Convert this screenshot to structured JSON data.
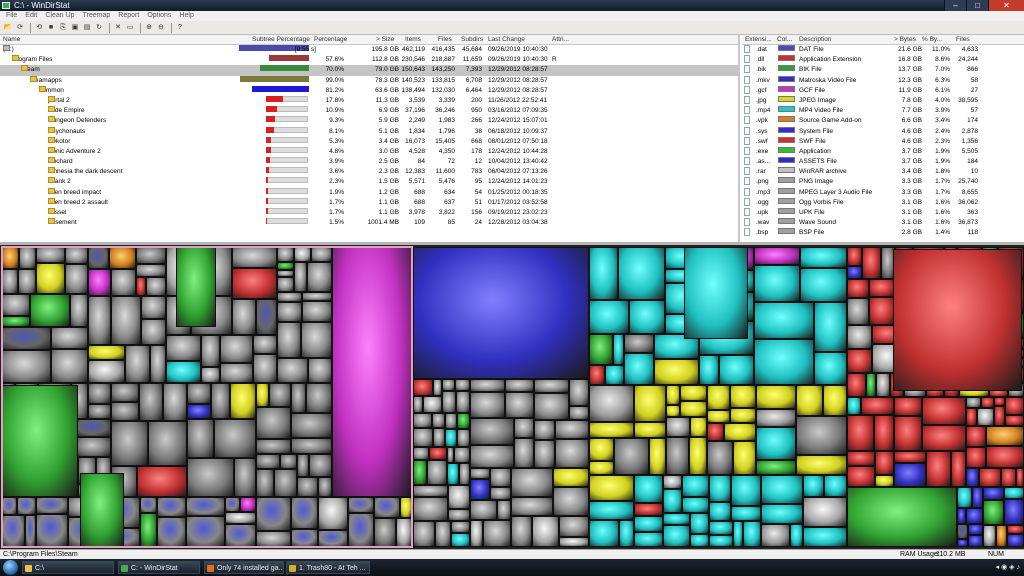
{
  "window": {
    "title": "C:\\ - WinDirStat"
  },
  "menu": [
    "File",
    "Edit",
    "Clean Up",
    "Treemap",
    "Report",
    "Options",
    "Help"
  ],
  "toolbar_icons": [
    "open-icon",
    "refresh-icon",
    "refresh-all-icon",
    "stop-icon",
    "copy-path-icon",
    "explorer-icon",
    "command-prompt-icon",
    "refresh-selected-icon",
    "delete-icon",
    "new-folder-icon",
    "zoom-in-icon",
    "zoom-out-icon",
    "help-icon"
  ],
  "tree": {
    "headers": {
      "name": "Name",
      "subtree": "Subtree Percentage",
      "pct": "Percentage",
      "size": "> Size",
      "items": "Items",
      "files": "Files",
      "subdirs": "Subdirs",
      "last": "Last Change",
      "attr": "Attri..."
    },
    "rows": [
      {
        "name": "(C:)",
        "subtree_text": "[9:55 s]",
        "pct": "",
        "size": "195.8 GB",
        "items": "462,119",
        "files": "416,435",
        "subdirs": "45,684",
        "last": "09/26/2019  10:40:30",
        "attr": "",
        "level": 0,
        "bar": 1.0,
        "bar_color": "#4a4aa8",
        "icon": "drive"
      },
      {
        "name": "Program Files",
        "subtree_text": "",
        "pct": "57.6%",
        "size": "112.8 GB",
        "items": "230,546",
        "files": "218,887",
        "subdirs": "11,659",
        "last": "09/26/2019  10:40:30",
        "attr": "R",
        "level": 1,
        "bar": 0.576,
        "bar_color": "#9a3a3a",
        "icon": "folder"
      },
      {
        "name": "Steam",
        "subtree_text": "",
        "pct": "70.0%",
        "size": "79.0 GB",
        "items": "150,643",
        "files": "143,250",
        "subdirs": "7,393",
        "last": "12/29/2012  08:28:57",
        "attr": "",
        "level": 2,
        "bar": 0.7,
        "bar_color": "#3a8a3a",
        "icon": "folder",
        "selected": true
      },
      {
        "name": "steamapps",
        "subtree_text": "",
        "pct": "99.0%",
        "size": "78.3 GB",
        "items": "140,523",
        "files": "133,815",
        "subdirs": "6,708",
        "last": "12/29/2012  08:28:57",
        "attr": "",
        "level": 3,
        "bar": 0.99,
        "bar_color": "#7a7a3a",
        "icon": "folder"
      },
      {
        "name": "common",
        "subtree_text": "",
        "pct": "81.2%",
        "size": "63.6 GB",
        "items": "138,494",
        "files": "132,030",
        "subdirs": "6,464",
        "last": "12/29/2012  08:28:57",
        "attr": "",
        "level": 4,
        "bar": 0.812,
        "bar_color": "#1a1ad8",
        "icon": "folder"
      },
      {
        "name": "portal 2",
        "subtree_text": "",
        "pct": "17.8%",
        "size": "11.3 GB",
        "items": "3,539",
        "files": "3,339",
        "subdirs": "200",
        "last": "11/26/2012  22:52:41",
        "attr": "",
        "level": 5,
        "bar": 0.178,
        "bar_color": "#d82020",
        "icon": "folder"
      },
      {
        "name": "Jade Empire",
        "subtree_text": "",
        "pct": "10.9%",
        "size": "6.9 GB",
        "items": "37,196",
        "files": "36,246",
        "subdirs": "950",
        "last": "03/16/2012  07:09:35",
        "attr": "",
        "level": 5,
        "bar": 0.109,
        "bar_color": "#d82020",
        "icon": "folder"
      },
      {
        "name": "Dungeon Defenders",
        "subtree_text": "",
        "pct": "9.3%",
        "size": "5.9 GB",
        "items": "2,249",
        "files": "1,983",
        "subdirs": "266",
        "last": "12/24/2012  15:07:01",
        "attr": "",
        "level": 5,
        "bar": 0.093,
        "bar_color": "#d82020",
        "icon": "folder"
      },
      {
        "name": "Psychonauts",
        "subtree_text": "",
        "pct": "8.1%",
        "size": "5.1 GB",
        "items": "1,834",
        "files": "1,796",
        "subdirs": "38",
        "last": "06/18/2012  10:09:37",
        "attr": "",
        "level": 5,
        "bar": 0.081,
        "bar_color": "#d82020",
        "icon": "folder"
      },
      {
        "name": "swkotor",
        "subtree_text": "",
        "pct": "5.3%",
        "size": "3.4 GB",
        "items": "16,073",
        "files": "15,405",
        "subdirs": "668",
        "last": "08/01/2012  07:50:18",
        "attr": "",
        "level": 5,
        "bar": 0.053,
        "bar_color": "#d82020",
        "icon": "folder"
      },
      {
        "name": "Sonic Adventure 2",
        "subtree_text": "",
        "pct": "4.8%",
        "size": "3.0 GB",
        "items": "4,528",
        "files": "4,350",
        "subdirs": "178",
        "last": "12/24/2012  10:44:28",
        "attr": "",
        "level": 5,
        "bar": 0.048,
        "bar_color": "#d82020",
        "icon": "folder"
      },
      {
        "name": "Rochard",
        "subtree_text": "",
        "pct": "3.9%",
        "size": "2.5 GB",
        "items": "84",
        "files": "72",
        "subdirs": "12",
        "last": "10/04/2012  13:40:42",
        "attr": "",
        "level": 5,
        "bar": 0.039,
        "bar_color": "#d82020",
        "icon": "folder"
      },
      {
        "name": "amnesia the dark descent",
        "subtree_text": "",
        "pct": "3.6%",
        "size": "2.3 GB",
        "items": "12,383",
        "files": "11,600",
        "subdirs": "783",
        "last": "06/04/2012  07:13:26",
        "attr": "",
        "level": 5,
        "bar": 0.036,
        "bar_color": "#d82020",
        "icon": "folder"
      },
      {
        "name": "shank 2",
        "subtree_text": "",
        "pct": "2.3%",
        "size": "1.5 GB",
        "items": "5,571",
        "files": "5,476",
        "subdirs": "95",
        "last": "12/24/2012  14:01:23",
        "attr": "",
        "level": 5,
        "bar": 0.023,
        "bar_color": "#d82020",
        "icon": "folder"
      },
      {
        "name": "alien breed impact",
        "subtree_text": "",
        "pct": "1.9%",
        "size": "1.2 GB",
        "items": "688",
        "files": "634",
        "subdirs": "54",
        "last": "01/25/2012  00:18:35",
        "attr": "",
        "level": 5,
        "bar": 0.019,
        "bar_color": "#d82020",
        "icon": "folder"
      },
      {
        "name": "alien breed 2 assault",
        "subtree_text": "",
        "pct": "1.7%",
        "size": "1.1 GB",
        "items": "688",
        "files": "637",
        "subdirs": "51",
        "last": "01/17/2012  03:52:58",
        "attr": "",
        "level": 5,
        "bar": 0.017,
        "bar_color": "#d82020",
        "icon": "folder"
      },
      {
        "name": "vessel",
        "subtree_text": "",
        "pct": "1.7%",
        "size": "1.1 GB",
        "items": "3,978",
        "files": "3,822",
        "subdirs": "156",
        "last": "09/19/2012  23:02:23",
        "attr": "",
        "level": 5,
        "bar": 0.017,
        "bar_color": "#d82020",
        "icon": "folder"
      },
      {
        "name": "basement",
        "subtree_text": "",
        "pct": "1.5%",
        "size": "1001.4 MB",
        "items": "109",
        "files": "85",
        "subdirs": "24",
        "last": "12/28/2012  03:04:38",
        "attr": "",
        "level": 5,
        "bar": 0.015,
        "bar_color": "#d82020",
        "icon": "folder"
      }
    ]
  },
  "extensions": {
    "headers": {
      "ext": "Extensi...",
      "color": "Col...",
      "desc": "Description",
      "bytes": "> Bytes",
      "pct": "% By...",
      "files": "Files"
    },
    "rows": [
      {
        "ext": ".dat",
        "color": "#4a4ab8",
        "desc": "DAT File",
        "bytes": "21.6 GB",
        "pct": "11.0%",
        "files": "4,633"
      },
      {
        "ext": ".dll",
        "color": "#c83030",
        "desc": "Application Extension",
        "bytes": "16.8 GB",
        "pct": "8.6%",
        "files": "24,244"
      },
      {
        "ext": ".bik",
        "color": "#30a030",
        "desc": "BIK File",
        "bytes": "13.7 GB",
        "pct": "7.0%",
        "files": "866"
      },
      {
        "ext": ".mkv",
        "color": "#3030c8",
        "desc": "Matroska Video File",
        "bytes": "12.3 GB",
        "pct": "6.3%",
        "files": "58"
      },
      {
        "ext": ".gcf",
        "color": "#c830c8",
        "desc": "GCF File",
        "bytes": "11.9 GB",
        "pct": "6.1%",
        "files": "27"
      },
      {
        "ext": ".jpg",
        "color": "#d8d820",
        "desc": "JPEG Image",
        "bytes": "7.8 GB",
        "pct": "4.0%",
        "files": "38,595"
      },
      {
        "ext": ".mp4",
        "color": "#20c8c8",
        "desc": "MP4 Video File",
        "bytes": "7.7 GB",
        "pct": "3.9%",
        "files": "57"
      },
      {
        "ext": ".vpk",
        "color": "#d88020",
        "desc": "Source Game Add-on",
        "bytes": "6.6 GB",
        "pct": "3.4%",
        "files": "174"
      },
      {
        "ext": ".sys",
        "color": "#3030d0",
        "desc": "System File",
        "bytes": "4.6 GB",
        "pct": "2.4%",
        "files": "2,878"
      },
      {
        "ext": ".swf",
        "color": "#d03030",
        "desc": "SWF File",
        "bytes": "4.6 GB",
        "pct": "2.3%",
        "files": "1,356"
      },
      {
        "ext": ".exe",
        "color": "#30c030",
        "desc": "Application",
        "bytes": "3.7 GB",
        "pct": "1.9%",
        "files": "5,505"
      },
      {
        "ext": ".as...",
        "color": "#3030c0",
        "desc": "ASSETS File",
        "bytes": "3.7 GB",
        "pct": "1.9%",
        "files": "184"
      },
      {
        "ext": ".rar",
        "color": "#c0c0c0",
        "desc": "WinRAR archive",
        "bytes": "3.4 GB",
        "pct": "1.8%",
        "files": "10"
      },
      {
        "ext": ".png",
        "color": "#a0a0a0",
        "desc": "PNG Image",
        "bytes": "3.3 GB",
        "pct": "1.7%",
        "files": "25,740"
      },
      {
        "ext": ".mp3",
        "color": "#a0a0a0",
        "desc": "MPEG Layer 3 Audio File",
        "bytes": "3.3 GB",
        "pct": "1.7%",
        "files": "8,655"
      },
      {
        "ext": ".ogg",
        "color": "#a0a0a0",
        "desc": "Ogg Vorbis File",
        "bytes": "3.1 GB",
        "pct": "1.6%",
        "files": "36,062"
      },
      {
        "ext": ".upk",
        "color": "#a0a0a0",
        "desc": "UPK File",
        "bytes": "3.1 GB",
        "pct": "1.6%",
        "files": "363"
      },
      {
        "ext": ".wav",
        "color": "#a0a0a0",
        "desc": "Wave Sound",
        "bytes": "3.1 GB",
        "pct": "1.6%",
        "files": "36,873"
      },
      {
        "ext": ".bsp",
        "color": "#a0a0a0",
        "desc": "BSP File",
        "bytes": "2.8 GB",
        "pct": "1.4%",
        "files": "118"
      }
    ]
  },
  "status": {
    "path": "C:\\Program Files\\Steam",
    "ram_label": "RAM Usage:",
    "ram_value": "110.2 MB",
    "num": "NUM"
  },
  "taskbar": {
    "tasks": [
      {
        "label": "C:\\",
        "color": "#e8c34c"
      },
      {
        "label": "C: - WinDirStat",
        "color": "#4da84d"
      },
      {
        "label": "Only 74 installed ga...",
        "color": "#e07020"
      },
      {
        "label": "1. Trash80 - At Teh ...",
        "color": "#d0b020"
      }
    ]
  }
}
